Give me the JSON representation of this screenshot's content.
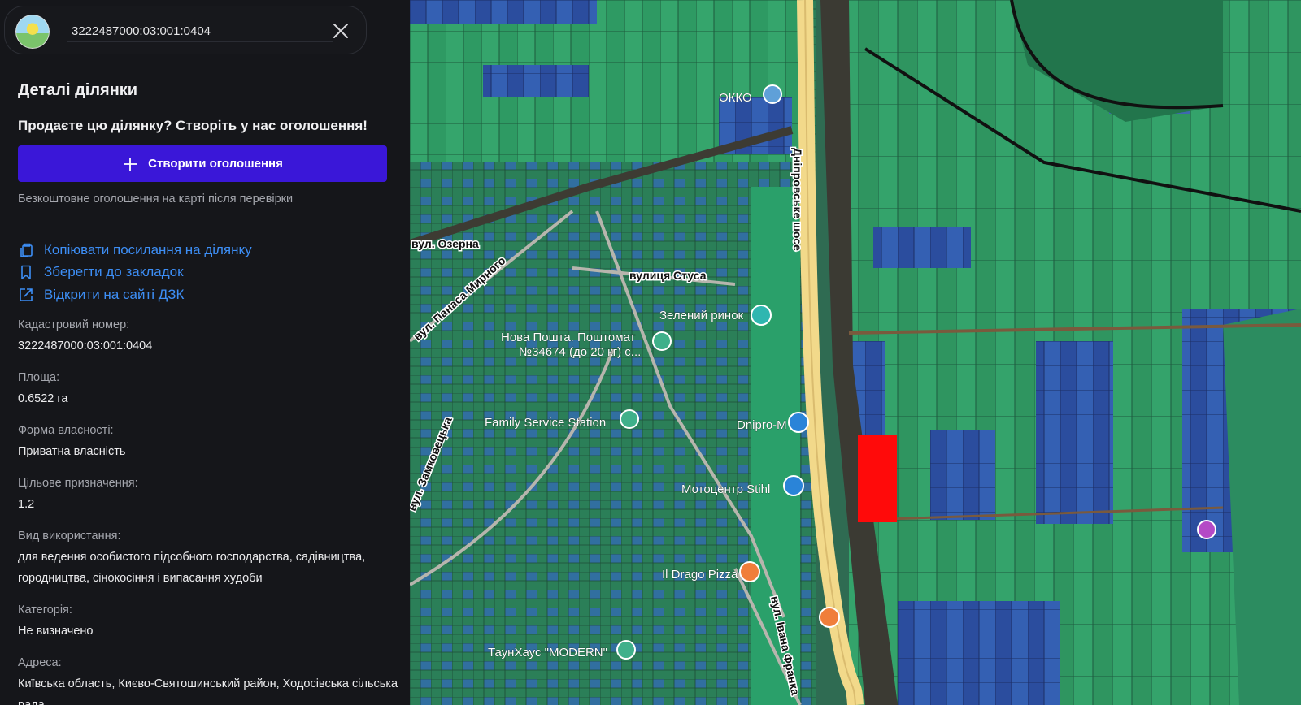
{
  "search": {
    "value": "3222487000:03:001:0404"
  },
  "panel": {
    "title": "Деталі ділянки",
    "promo_title": "Продаєте цю ділянку? Створіть у нас оголошення!",
    "create_button": "Створити оголошення",
    "promo_note": "Безкоштовне оголошення на карті після перевірки"
  },
  "links": {
    "copy": "Копіювати посилання на ділянку",
    "bookmark": "Зберегти до закладок",
    "open_dzk": "Відкрити на сайті ДЗК"
  },
  "fields": [
    {
      "label": "Кадастровий номер:",
      "value": "3222487000:03:001:0404"
    },
    {
      "label": "Площа:",
      "value": "0.6522 га"
    },
    {
      "label": "Форма власності:",
      "value": "Приватна власність"
    },
    {
      "label": "Цільове призначення:",
      "value": "1.2"
    },
    {
      "label": "Вид використання:",
      "value": "для ведення особистого підсобного господарства, садівництва, городництва, сінокосіння і випасання худоби"
    },
    {
      "label": "Категорія:",
      "value": "Не визначено"
    },
    {
      "label": "Адреса:",
      "value": "Київська область, Києво-Святошинський район, Ходосівська сільська рада"
    }
  ],
  "map": {
    "labels": {
      "okko": "ОККО",
      "dniprovske": "Дніпровське шосе",
      "ozerna": "вул. Озерна",
      "stusa": "вулиця Стуса",
      "panasa": "вул. Панаса Мирного",
      "zeleny": "Зелений ринок",
      "novaposhta_1": "Нова Пошта. Поштомат",
      "novaposhta_2": "№34674 (до 20 кг) с...",
      "family": "Family Service Station",
      "dnipro_m": "Dnipro-M",
      "zamkovetska": "вул. Замковецька",
      "moto": "Мотоцентр Stihl",
      "pizza": "Il Drago Pizza",
      "franka": "вул. Івана Франка",
      "taunhaus": "ТаунХаус \"MODERN\""
    },
    "colors": {
      "selected_parcel": "#ff0a0a",
      "parcel_green": "#2fae6e",
      "parcel_blue": "#2d4fa8",
      "road": "#f2d98a"
    }
  }
}
